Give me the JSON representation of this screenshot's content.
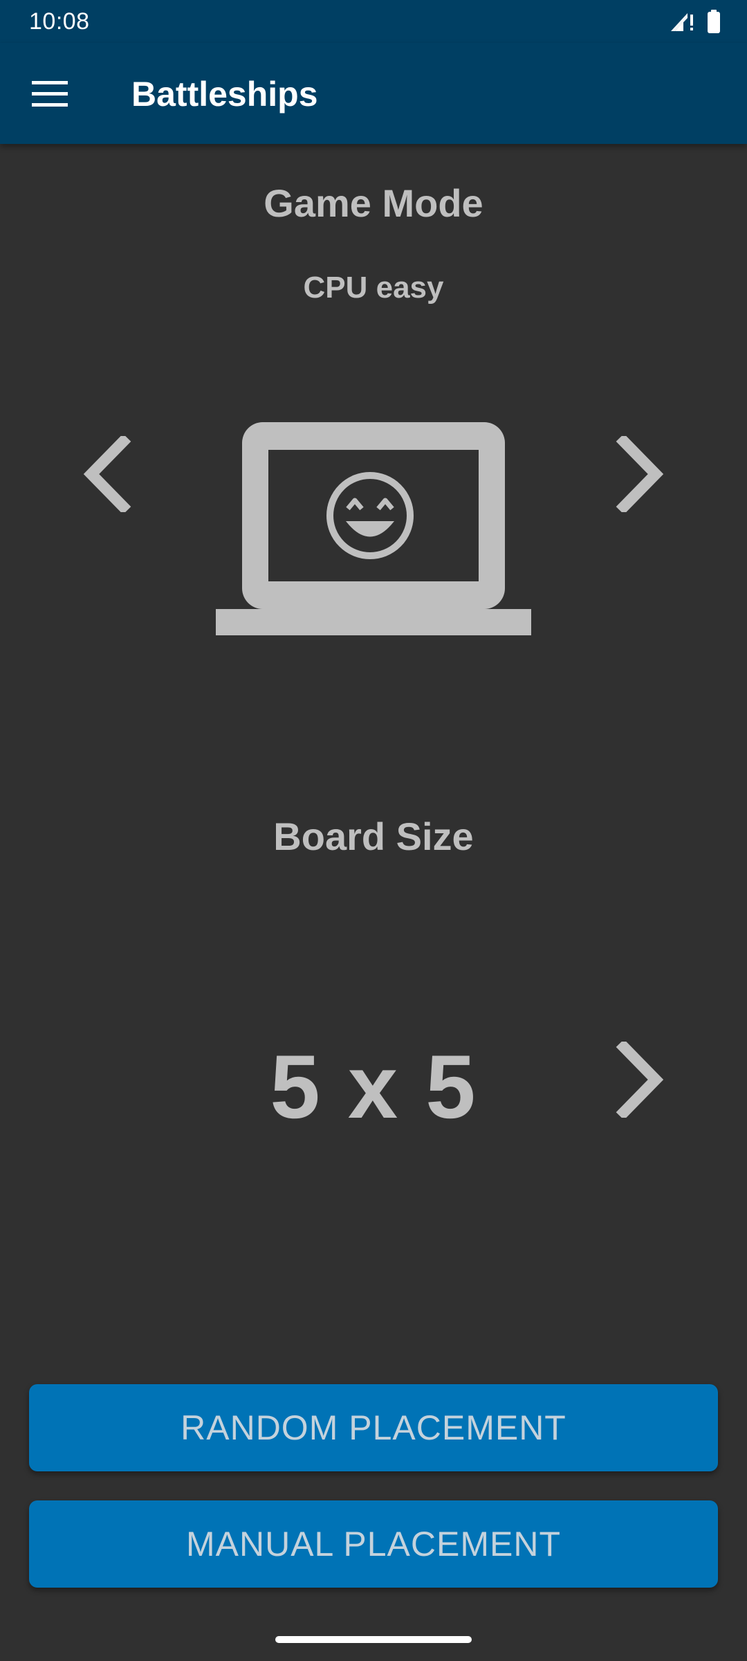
{
  "status_bar": {
    "time": "10:08",
    "icons": [
      "signal-alert-icon",
      "battery-icon"
    ]
  },
  "app_bar": {
    "title": "Battleships",
    "menu_icon": "hamburger-menu-icon"
  },
  "game_mode": {
    "heading": "Game Mode",
    "selected": "CPU easy",
    "icon": "laptop-smiling-face-icon"
  },
  "board_size": {
    "heading": "Board Size",
    "selected": "5 x 5"
  },
  "buttons": {
    "random": "RANDOM PLACEMENT",
    "manual": "MANUAL PLACEMENT"
  },
  "colors": {
    "app_bar": "#003f63",
    "background": "#303030",
    "text": "#bfbfbf",
    "button": "#0073b6"
  }
}
